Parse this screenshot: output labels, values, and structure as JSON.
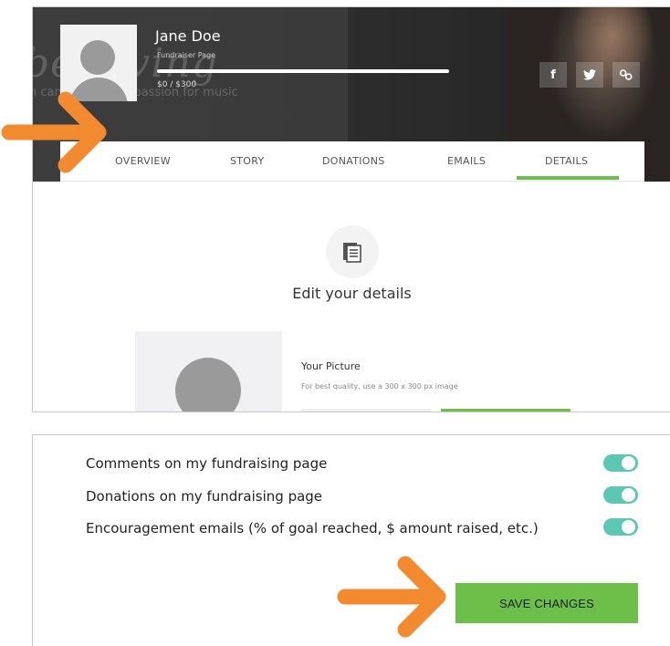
{
  "profile": {
    "name": "Jane Doe",
    "subtitle": "Fundraiser Page",
    "amount": "$0 / $300",
    "hero_title_fragment": "believing",
    "hero_subtitle_fragment": "n can pursue her passion for music"
  },
  "social": [
    {
      "name": "facebook",
      "glyph": "f"
    },
    {
      "name": "twitter",
      "glyph": "🐦"
    },
    {
      "name": "link",
      "glyph": "⚭"
    }
  ],
  "tabs": {
    "overview": "OVERVIEW",
    "story": "STORY",
    "donations": "DONATIONS",
    "emails": "EMAILS",
    "details": "DETAILS",
    "active": "DETAILS"
  },
  "details": {
    "title": "Edit your details",
    "picture_title": "Your Picture",
    "picture_hint": "For best quality, use a 300 x 300 px image"
  },
  "settings": [
    {
      "label": "Comments on my fundraising page",
      "enabled": true
    },
    {
      "label": "Donations on my fundraising page",
      "enabled": true
    },
    {
      "label": "Encouragement emails (% of goal reached, $ amount raised, etc.)",
      "enabled": true
    }
  ],
  "actions": {
    "save_label": "SAVE CHANGES"
  },
  "colors": {
    "accent_green": "#6cc04a",
    "toggle_teal": "#5cc7b3",
    "arrow_orange": "#f28a30"
  }
}
